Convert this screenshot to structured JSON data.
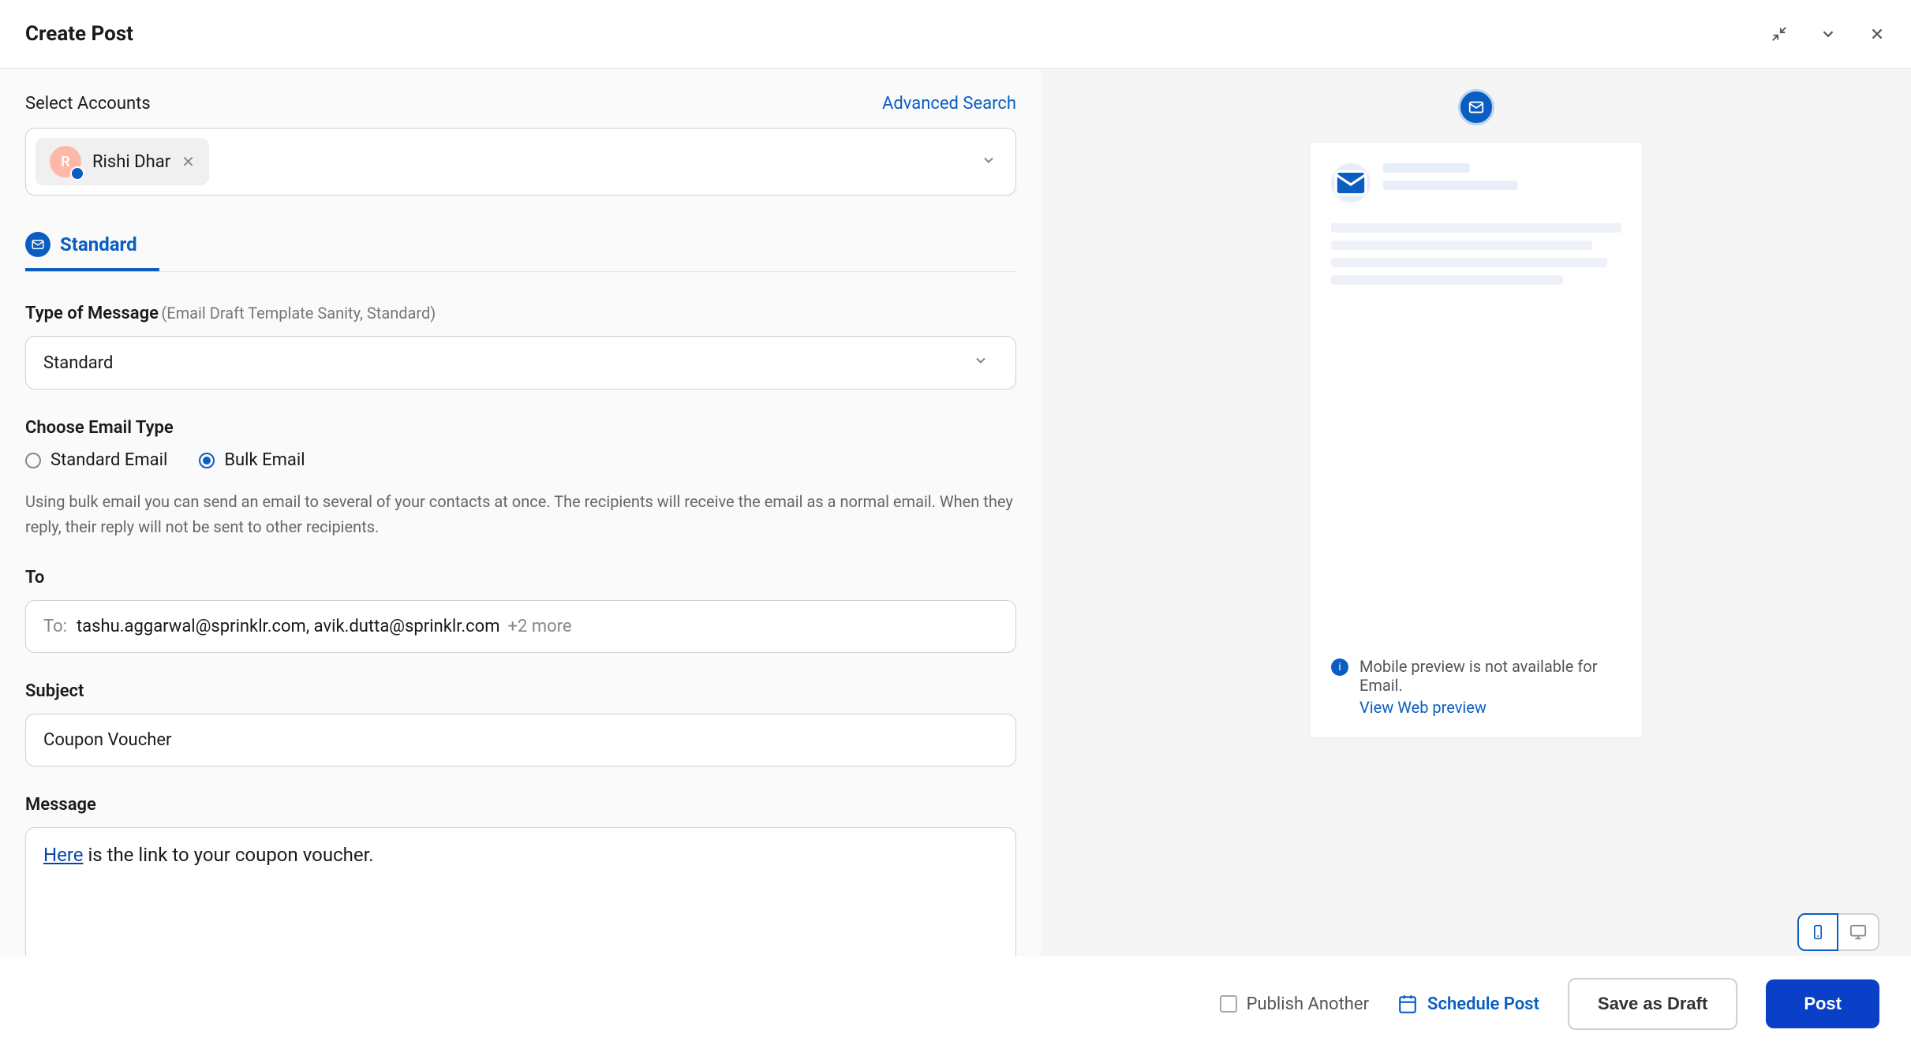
{
  "header": {
    "title": "Create Post"
  },
  "accounts": {
    "label": "Select Accounts",
    "advanced_search": "Advanced Search",
    "selected": {
      "name": "Rishi Dhar",
      "initial": "R"
    }
  },
  "tab": {
    "label": "Standard"
  },
  "type_of_message": {
    "label": "Type of Message",
    "sublabel": "(Email Draft Template Sanity, Standard)",
    "value": "Standard"
  },
  "email_type": {
    "label": "Choose Email Type",
    "options": {
      "standard": "Standard Email",
      "bulk": "Bulk Email"
    },
    "selected": "bulk",
    "helper": "Using bulk email you can send an email to several of your contacts at once. The recipients will receive the email as a normal email. When they reply, their reply will not be sent to other recipients."
  },
  "to": {
    "label": "To",
    "prefix": "To:",
    "emails": "tashu.aggarwal@sprinklr.com, avik.dutta@sprinklr.com",
    "more": "+2 more"
  },
  "subject": {
    "label": "Subject",
    "value": "Coupon Voucher"
  },
  "message": {
    "label": "Message",
    "link_text": "Here",
    "rest_text": " is the link to your coupon voucher."
  },
  "preview": {
    "notice": "Mobile preview is not available for Email.",
    "link": "View Web preview"
  },
  "footer": {
    "publish_another": "Publish Another",
    "schedule": "Schedule Post",
    "save_draft": "Save as Draft",
    "post": "Post"
  }
}
